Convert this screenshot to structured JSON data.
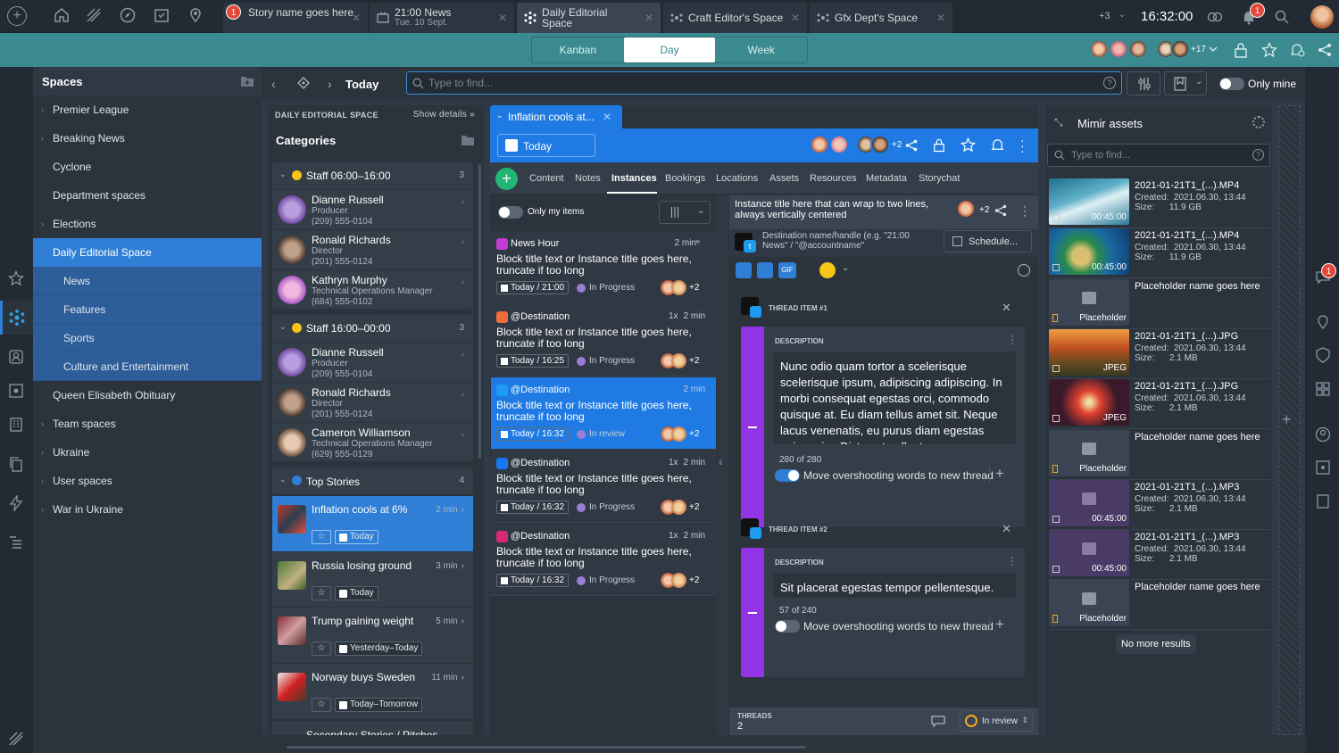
{
  "topbar": {
    "tabs": [
      {
        "title": "Story name goes here",
        "subtitle": "",
        "badge": "1"
      },
      {
        "title": "21:00 News",
        "subtitle": "Tue. 10 Sept."
      },
      {
        "title": "Daily Editorial Space",
        "subtitle": ""
      },
      {
        "title": "Craft Editor's Space",
        "subtitle": ""
      },
      {
        "title": "Gfx Dept's Space",
        "subtitle": ""
      }
    ],
    "overflow": "+3",
    "time": "16:32:00",
    "notif_badge": "1"
  },
  "views": {
    "kanban": "Kanban",
    "day": "Day",
    "week": "Week"
  },
  "presence": {
    "more": "+17"
  },
  "spaces": {
    "title": "Spaces",
    "items": [
      {
        "label": "Premier League",
        "caret": true
      },
      {
        "label": "Breaking News",
        "caret": true
      },
      {
        "label": "Cyclone",
        "caret": false
      },
      {
        "label": "Department spaces",
        "caret": false
      },
      {
        "label": "Elections",
        "caret": true
      },
      {
        "label": "Daily Editorial Space",
        "caret": true
      },
      {
        "label": "News",
        "caret": false
      },
      {
        "label": "Features",
        "caret": false
      },
      {
        "label": "Sports",
        "caret": false
      },
      {
        "label": "Culture and Entertainment",
        "caret": false
      },
      {
        "label": "Queen Elisabeth Obituary",
        "caret": false
      },
      {
        "label": "Team spaces",
        "caret": true
      },
      {
        "label": "Ukraine",
        "caret": true
      },
      {
        "label": "User spaces",
        "caret": true
      },
      {
        "label": "War in Ukraine",
        "caret": true
      }
    ]
  },
  "nav": {
    "today": "Today",
    "find_placeholder": "Type to find...",
    "only_mine": "Only mine"
  },
  "categories": {
    "space_label": "DAILY EDITORIAL SPACE",
    "show_details": "Show details",
    "title": "Categories",
    "groups": [
      {
        "name": "Staff 06:00–16:00",
        "count": "3",
        "people": [
          {
            "name": "Dianne Russell",
            "role": "Producer",
            "phone": "(209) 555-0104"
          },
          {
            "name": "Ronald Richards",
            "role": "Director",
            "phone": "(201) 555-0124"
          },
          {
            "name": "Kathryn Murphy",
            "role": "Technical Operations Manager",
            "phone": "(684) 555-0102"
          }
        ]
      },
      {
        "name": "Staff 16:00–00:00",
        "count": "3",
        "people": [
          {
            "name": "Dianne Russell",
            "role": "Producer",
            "phone": "(209) 555-0104"
          },
          {
            "name": "Ronald Richards",
            "role": "Director",
            "phone": "(201) 555-0124"
          },
          {
            "name": "Cameron Williamson",
            "role": "Technical Operations Manager",
            "phone": "(629) 555-0129"
          }
        ]
      }
    ],
    "top_stories": {
      "name": "Top Stories",
      "count": "4"
    },
    "stories": [
      {
        "title": "Inflation cools at 6%",
        "min": "2 min",
        "date": "Today"
      },
      {
        "title": "Russia losing ground",
        "min": "3 min",
        "date": "Today"
      },
      {
        "title": "Trump gaining weight",
        "min": "5 min",
        "date": "Yesterday–Today"
      },
      {
        "title": "Norway buys Sweden",
        "min": "11 min",
        "date": "Today–Tomorrow"
      }
    ],
    "next_group": "Secondary Stories / Pitches"
  },
  "story": {
    "tab_title": "Inflation cools at...",
    "date": "Today",
    "avatars_more": "+2",
    "subtabs": [
      "Content",
      "Notes",
      "Instances",
      "Bookings",
      "Locations",
      "Assets",
      "Resources",
      "Metadata",
      "Storychat"
    ],
    "only_my_items": "Only my items",
    "instances": [
      {
        "source": "News Hour",
        "min": "2 min",
        "title": "Block title text or Instance title goes here, truncate if too long",
        "date": "Today / 21:00",
        "status": "In Progress",
        "more": "+2",
        "pinned": true,
        "ico": "TV"
      },
      {
        "source": "@Destination",
        "min": "2 min",
        "title": "Block title text or Instance title goes here, truncate if too long",
        "date": "Today / 16:25",
        "status": "In Progress",
        "more": "+2",
        "ico": "CMS",
        "views": "1x"
      },
      {
        "source": "@Destination",
        "min": "2 min",
        "title": "Block title text or Instance title goes here, truncate if too long",
        "date": "Today / 16:32",
        "status": "In review",
        "more": "+2",
        "ico": "tw"
      },
      {
        "source": "@Destination",
        "min": "2 min",
        "title": "Block title text or Instance title goes here, truncate if too long",
        "date": "Today / 16:32",
        "status": "In Progress",
        "more": "+2",
        "ico": "fb",
        "views": "1x"
      },
      {
        "source": "@Destination",
        "min": "2 min",
        "title": "Block title text or Instance title goes here, truncate if too long",
        "date": "Today / 16:32",
        "status": "In Progress",
        "more": "+2",
        "ico": "ig",
        "views": "1x"
      }
    ],
    "detail": {
      "title": "Instance title here that can wrap to two lines, always vertically centered",
      "more": "+2",
      "destination": "Destination name/handle (e.g. \"21:00 News\" / \"@accountname\"",
      "schedule": "Schedule...",
      "gif": "GIF",
      "threads": [
        {
          "label": "THREAD ITEM #1",
          "desc_label": "DESCRIPTION",
          "text": "Nunc odio quam tortor a scelerisque scelerisque ipsum, adipiscing adipiscing. In morbi consequat egestas orci, commodo quisque at. Eu diam tellus amet sit. Neque lacus venenatis, eu purus diam egestas enim enim. Dictumst pellentesque neque",
          "counter": "280 of 280",
          "move": "Move overshooting words to new thread"
        },
        {
          "label": "THREAD ITEM #2",
          "desc_label": "DESCRIPTION",
          "text": "Sit placerat egestas tempor pellentesque.",
          "counter": "57 of 240",
          "move": "Move overshooting words to new thread"
        }
      ],
      "threads_label": "THREADS",
      "threads_count": "2",
      "review_status": "In review"
    }
  },
  "mimir": {
    "title": "Mimir assets",
    "placeholder": "Type to find...",
    "assets": [
      {
        "name": "2021-01-21T1_(...).MP4",
        "created": "Created:  2021.06.30, 13:44",
        "size": "Size:      11.9 GB",
        "dur": "00:45:00",
        "kind": "sea"
      },
      {
        "name": "2021-01-21T1_(...).MP4",
        "created": "Created:  2021.06.30, 13:44",
        "size": "Size:      11.9 GB",
        "dur": "00:45:00",
        "kind": "island"
      },
      {
        "name": "Placeholder name goes here",
        "created": "",
        "size": "",
        "dur": "Placeholder",
        "kind": "ph"
      },
      {
        "name": "2021-01-21T1_(...).JPG",
        "created": "Created:  2021.06.30, 13:44",
        "size": "Size:      2.1 MB",
        "dur": "JPEG",
        "kind": "sunset"
      },
      {
        "name": "2021-01-21T1_(...).JPG",
        "created": "Created:  2021.06.30, 13:44",
        "size": "Size:      2.1 MB",
        "dur": "JPEG",
        "kind": "fire"
      },
      {
        "name": "Placeholder name goes here",
        "created": "",
        "size": "",
        "dur": "Placeholder",
        "kind": "ph"
      },
      {
        "name": "2021-01-21T1_(...).MP3",
        "created": "Created:  2021.06.30, 13:44",
        "size": "Size:      2.1 MB",
        "dur": "00:45:00",
        "kind": "audio"
      },
      {
        "name": "2021-01-21T1_(...).MP3",
        "created": "Created:  2021.06.30, 13:44",
        "size": "Size:      2.1 MB",
        "dur": "00:45:00",
        "kind": "audio"
      },
      {
        "name": "Placeholder name goes here",
        "created": "",
        "size": "",
        "dur": "Placeholder",
        "kind": "ph"
      }
    ],
    "no_more": "No more results"
  },
  "right_rail": {
    "badge": "1"
  }
}
